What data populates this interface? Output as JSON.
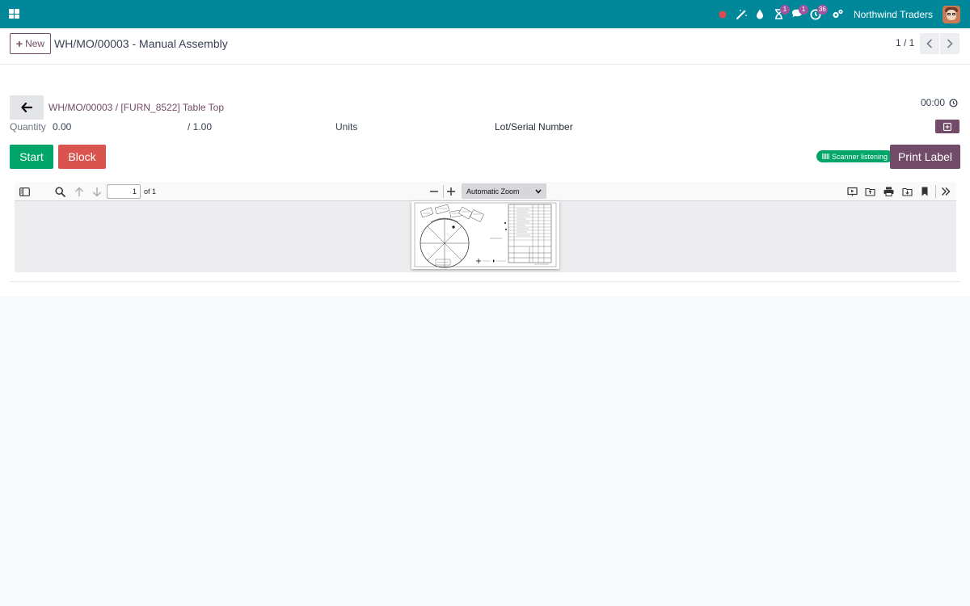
{
  "navbar": {
    "company": "Northwind Traders",
    "icons": {
      "apps": "apps-grid-icon",
      "record": "recording-dot-icon",
      "wand": "magic-wand-icon",
      "drop": "droplet-icon",
      "activity": "hourglass-icon",
      "messages": "chat-icon",
      "timer": "clock-icon",
      "settings": "gears-icon"
    },
    "badges": {
      "activity": "1",
      "messages": "1",
      "timer": "36"
    },
    "colors": {
      "bar": "#00879a",
      "badge": "#a0549e",
      "record": "#e04b4b"
    }
  },
  "control": {
    "new_label": "New",
    "title": "WH/MO/00003 - Manual Assembly",
    "pager": "1 / 1"
  },
  "workorder": {
    "breadcrumb": "WH/MO/00003 / [FURN_8522] Table Top",
    "timer": "00:00",
    "quantity_label": "Quantity",
    "quantity_done": "0.00",
    "quantity_total": "/ 1.00",
    "uom": "Units",
    "lot_label": "Lot/Serial Number",
    "start_label": "Start",
    "block_label": "Block",
    "scanner_label": "Scanner listening",
    "print_label": "Print Label",
    "colors": {
      "start": "#00a56a",
      "block": "#d9534f",
      "primary": "#714b67"
    }
  },
  "pdf_viewer": {
    "page_number": "1",
    "page_of": "of 1",
    "zoom": "Automatic Zoom"
  }
}
